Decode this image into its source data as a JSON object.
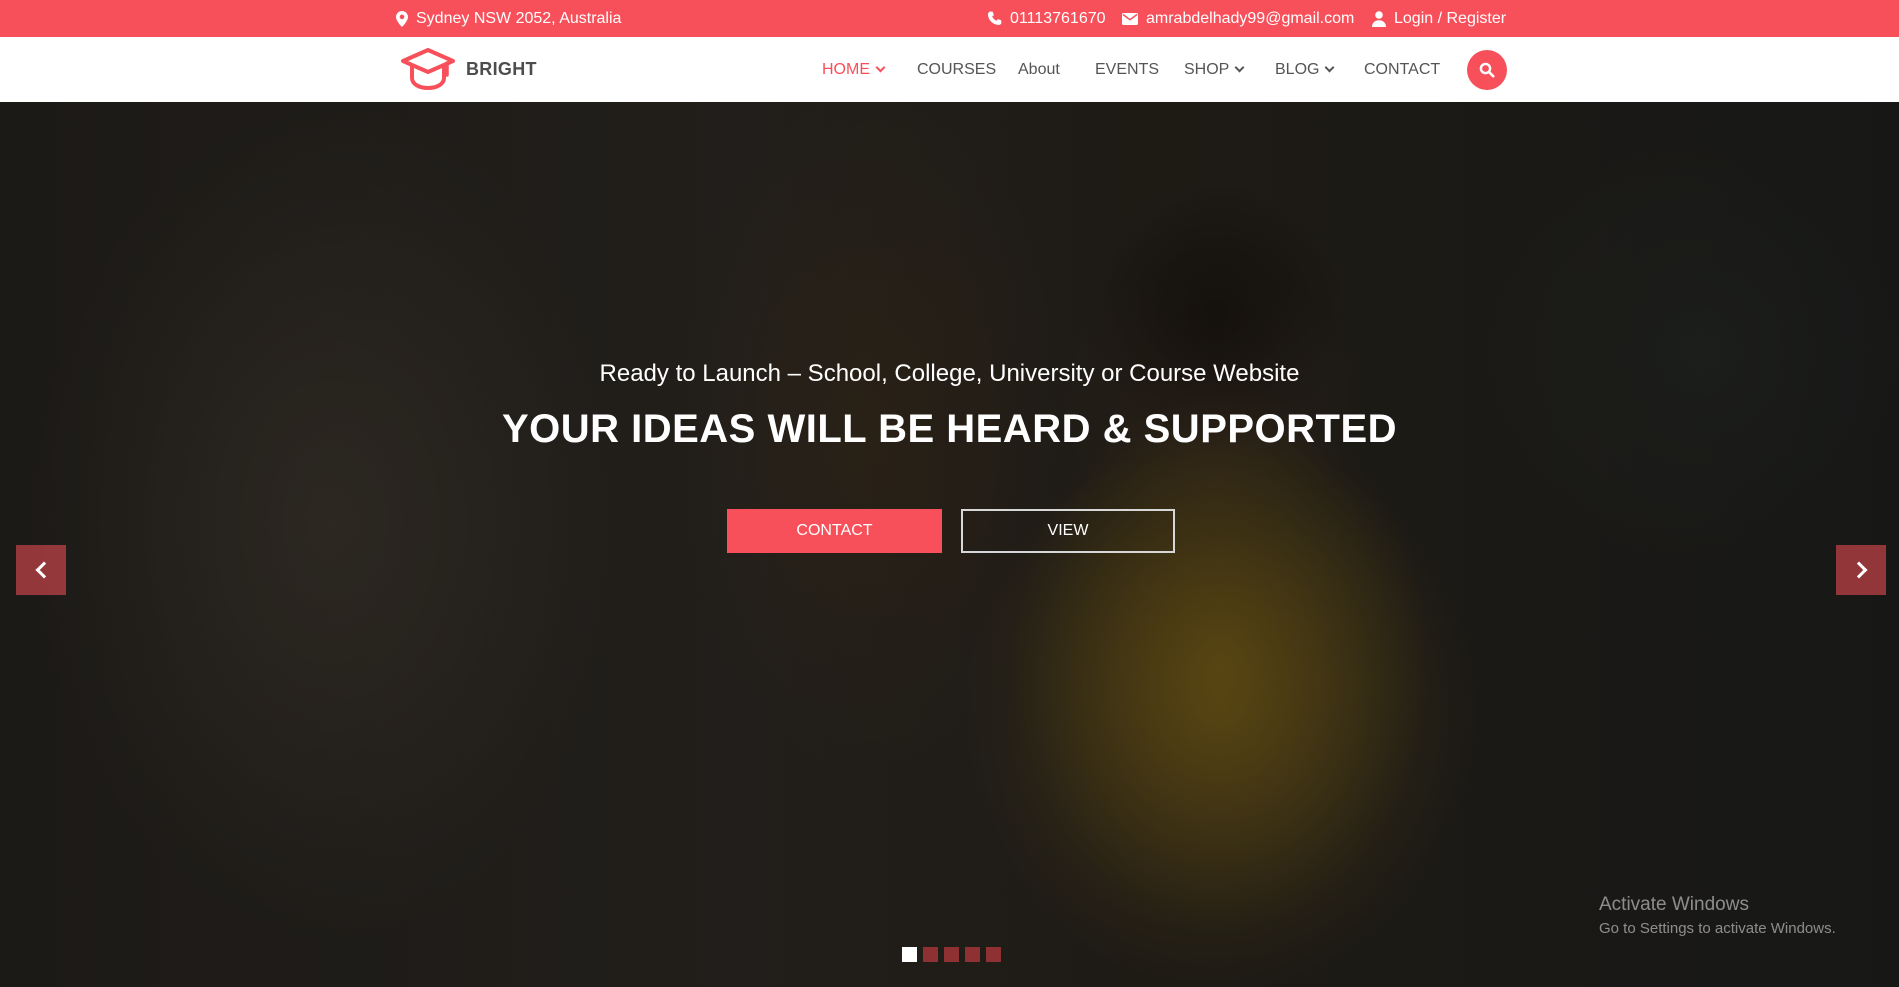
{
  "topbar": {
    "address": "Sydney NSW 2052, Australia",
    "phone": "01113761670",
    "email": "amrabdelhady99@gmail.com",
    "login": "Login / Register",
    "icons": [
      "map-marker-icon",
      "phone-icon",
      "envelope-icon",
      "user-icon"
    ]
  },
  "brand": {
    "name": "BRIGHT",
    "icon": "graduation-cap-icon"
  },
  "nav": {
    "items": [
      {
        "label": "HOME",
        "active": true,
        "dropdown": true
      },
      {
        "label": "COURSES",
        "active": false,
        "dropdown": false
      },
      {
        "label": "About",
        "active": false,
        "dropdown": false
      },
      {
        "label": "EVENTS",
        "active": false,
        "dropdown": false
      },
      {
        "label": "SHOP",
        "active": false,
        "dropdown": true
      },
      {
        "label": "BLOG",
        "active": false,
        "dropdown": true
      },
      {
        "label": "CONTACT",
        "active": false,
        "dropdown": false
      }
    ],
    "search_icon": "search-icon"
  },
  "hero": {
    "subtitle": "Ready to Launch – School, College, University or Course Website",
    "title": "YOUR IDEAS WILL BE HEARD & SUPPORTED",
    "primary_button": "CONTACT",
    "secondary_button": "VIEW",
    "slide_count": 5,
    "active_slide": 1
  },
  "watermark": {
    "title": "Activate Windows",
    "subtitle": "Go to Settings to activate Windows."
  },
  "colors": {
    "accent": "#f8505a",
    "nav_text": "#555555",
    "brand_text": "#4d4d4d"
  }
}
